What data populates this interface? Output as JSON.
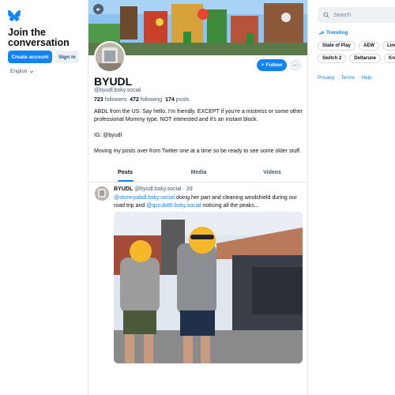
{
  "colors": {
    "accent": "#1083fe",
    "text": "#0b0f14",
    "muted": "#42576c",
    "border": "#e4e8ec"
  },
  "left": {
    "logo_icon": "butterfly-icon",
    "join_title": "Join the conversation",
    "create_account_label": "Create account",
    "sign_in_label": "Sign in",
    "language": "English"
  },
  "profile": {
    "display_name": "BYUDL",
    "handle": "@byudl.bsky.social",
    "followers_count": "723",
    "followers_label": "followers",
    "following_count": "472",
    "following_label": "following",
    "posts_count": "174",
    "posts_label": "posts",
    "follow_label": "Follow",
    "bio": [
      "ABDL from the US.  Say hello, I'm friendly.  EXCEPT if you're a mistress or some other professional Mommy type.  NOT interested and it's an instant block.",
      "IG: @byudl",
      "Moving my posts over from Twitter one at a time so be ready to see some older stuff."
    ]
  },
  "tabs": [
    {
      "label": "Posts",
      "active": true
    },
    {
      "label": "Media",
      "active": false
    },
    {
      "label": "Videos",
      "active": false
    }
  ],
  "post": {
    "author": "BYUDL",
    "handle": "@byudl.bsky.social",
    "separator": "·",
    "time": "2d",
    "mention1": "@stormyabdl.bsky.social",
    "text1": " doing her part and cleaning windshield during our road trip and ",
    "mention2": "@qccub86.bsky.social",
    "text2": " noticing all the peaks..."
  },
  "right": {
    "search_placeholder": "Search",
    "trending_label": "Trending",
    "trends": [
      "State of Play",
      "AEW",
      "Linda",
      "Switch 2",
      "Deltarune",
      "Knicks"
    ],
    "links": [
      "Privacy",
      "Terms",
      "Help"
    ],
    "link_separator": "·"
  }
}
